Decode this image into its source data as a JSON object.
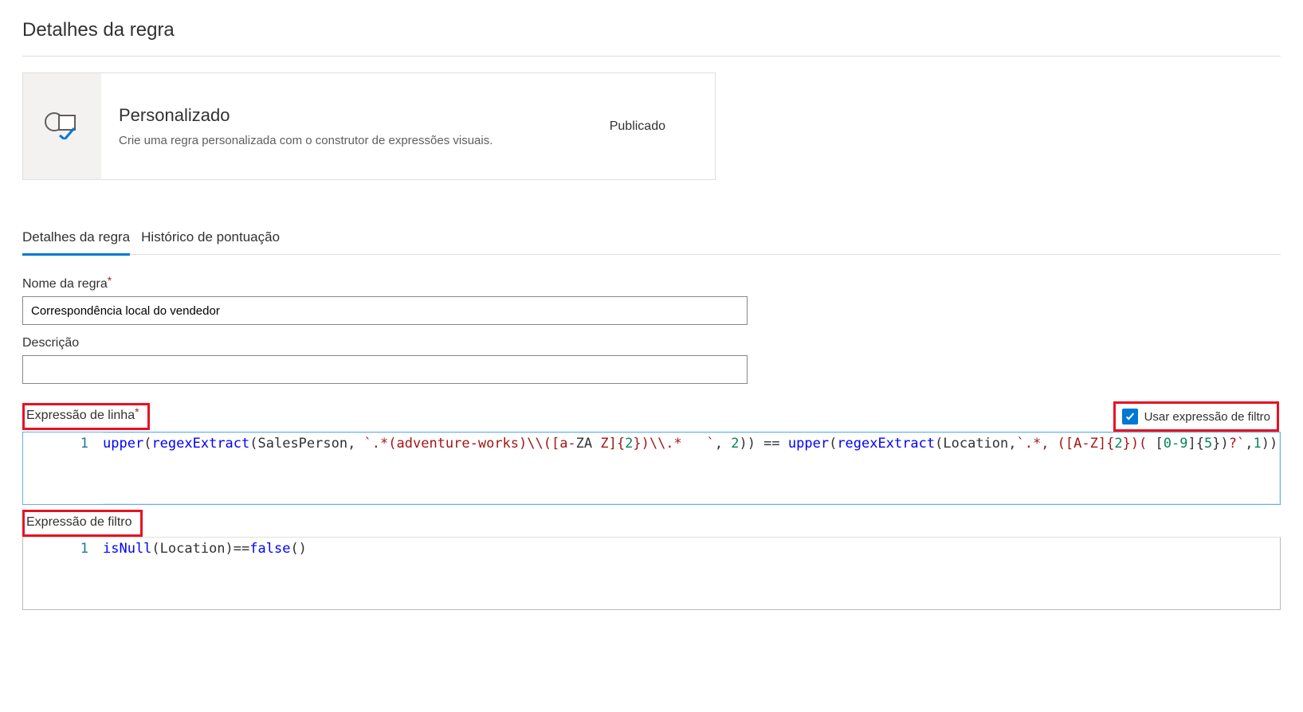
{
  "page": {
    "title": "Detalhes da regra"
  },
  "card": {
    "title": "Personalizado",
    "description": "Crie uma regra personalizada com o construtor de expressões visuais.",
    "status": "Publicado"
  },
  "tabs": {
    "items": [
      {
        "label": "Detalhes da regra",
        "active": true
      },
      {
        "label": "Histórico de pontuação",
        "active": false
      }
    ]
  },
  "form": {
    "ruleName": {
      "label": "Nome da regra",
      "required": true,
      "value": "Correspondência local do vendedor"
    },
    "description": {
      "label": "Descrição",
      "value": ""
    }
  },
  "rowExpression": {
    "label": "Expressão de linha",
    "required": true,
    "filterCheckbox": {
      "checked": true,
      "label": "Usar expressão de filtro"
    },
    "lineNumber": "1",
    "tokens": [
      {
        "t": "fn",
        "v": "upper"
      },
      {
        "t": "op",
        "v": "("
      },
      {
        "t": "fn",
        "v": "regexExtract"
      },
      {
        "t": "op",
        "v": "(SalesPerson, "
      },
      {
        "t": "str",
        "v": "`.*(adventure-works)\\\\([a-"
      },
      {
        "t": "op",
        "v": "ZA"
      },
      {
        "t": "str",
        "v": " Z]{"
      },
      {
        "t": "num",
        "v": "2"
      },
      {
        "t": "str",
        "v": "})\\\\.*   `"
      },
      {
        "t": "op",
        "v": ", "
      },
      {
        "t": "num",
        "v": "2"
      },
      {
        "t": "op",
        "v": ")) == "
      },
      {
        "t": "fn",
        "v": "upper"
      },
      {
        "t": "op",
        "v": "("
      },
      {
        "t": "fn",
        "v": "regexExtract"
      },
      {
        "t": "op",
        "v": "(Location,"
      },
      {
        "t": "str",
        "v": "`.*, ([A-Z]{"
      },
      {
        "t": "num",
        "v": "2"
      },
      {
        "t": "str",
        "v": "})( "
      },
      {
        "t": "op",
        "v": "["
      },
      {
        "t": "num",
        "v": "0-9"
      },
      {
        "t": "op",
        "v": "]{"
      },
      {
        "t": "num",
        "v": "5"
      },
      {
        "t": "op",
        "v": "})"
      },
      {
        "t": "str",
        "v": "?`"
      },
      {
        "t": "op",
        "v": ","
      },
      {
        "t": "num",
        "v": "1"
      },
      {
        "t": "op",
        "v": "))"
      }
    ]
  },
  "filterExpression": {
    "label": "Expressão de filtro",
    "lineNumber": "1",
    "tokens": [
      {
        "t": "fn",
        "v": "isNull"
      },
      {
        "t": "op",
        "v": "(Location)=="
      },
      {
        "t": "bool",
        "v": "false"
      },
      {
        "t": "op",
        "v": "()"
      }
    ]
  }
}
